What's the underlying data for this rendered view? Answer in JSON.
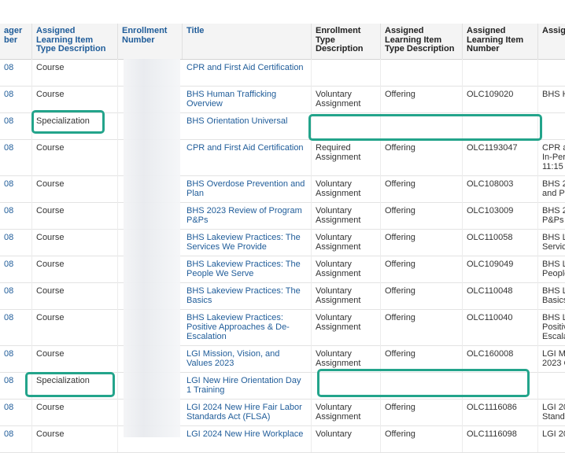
{
  "columns": [
    {
      "key": "c0",
      "label": "ager\nber"
    },
    {
      "key": "c1",
      "label": "Assigned Learning Item Type Description"
    },
    {
      "key": "c2",
      "label": "Enrollment Number"
    },
    {
      "key": "c3",
      "label": "Title"
    },
    {
      "key": "c4",
      "label": "Enrollment Type Description"
    },
    {
      "key": "c5",
      "label": "Assigned Learning Item Type Description"
    },
    {
      "key": "c6",
      "label": "Assigned Learning Item Number"
    },
    {
      "key": "c7",
      "label": "Assig"
    }
  ],
  "rows": [
    {
      "c0": "08",
      "c1": "Course",
      "c3": "CPR and First Aid Certification",
      "c4": "",
      "c5": "",
      "c6": "",
      "c7": ""
    },
    {
      "c0": "08",
      "c1": "Course",
      "c3": "BHS Human Trafficking Overview",
      "c4": "Voluntary Assignment",
      "c5": "Offering",
      "c6": "OLC109020",
      "c7": "BHS H"
    },
    {
      "c0": "08",
      "c1": "Specialization",
      "c3": "BHS Orientation Universal",
      "c4": "",
      "c5": "",
      "c6": "",
      "c7": ""
    },
    {
      "c0": "08",
      "c1": "Course",
      "c3": "CPR and First Aid Certification",
      "c4": "Required Assignment",
      "c5": "Offering",
      "c6": "OLC1193047",
      "c7": "CPR a\nIn-Pers\n11:15"
    },
    {
      "c0": "08",
      "c1": "Course",
      "c3": "BHS Overdose Prevention and Plan",
      "c4": "Voluntary Assignment",
      "c5": "Offering",
      "c6": "OLC108003",
      "c7": "BHS 2\nand P"
    },
    {
      "c0": "08",
      "c1": "Course",
      "c3": "BHS 2023 Review of Program P&Ps",
      "c4": "Voluntary Assignment",
      "c5": "Offering",
      "c6": "OLC103009",
      "c7": "BHS 2\nP&Ps"
    },
    {
      "c0": "08",
      "c1": "Course",
      "c3": "BHS Lakeview Practices: The Services We Provide",
      "c4": "Voluntary Assignment",
      "c5": "Offering",
      "c6": "OLC110058",
      "c7": "BHS L\nServic"
    },
    {
      "c0": "08",
      "c1": "Course",
      "c3": "BHS Lakeview Practices: The People We Serve",
      "c4": "Voluntary Assignment",
      "c5": "Offering",
      "c6": "OLC109049",
      "c7": "BHS L\nPeople"
    },
    {
      "c0": "08",
      "c1": "Course",
      "c3": "BHS Lakeview Practices: The Basics",
      "c4": "Voluntary Assignment",
      "c5": "Offering",
      "c6": "OLC110048",
      "c7": "BHS L\nBasics"
    },
    {
      "c0": "08",
      "c1": "Course",
      "c3": "BHS Lakeview Practices: Positive Approaches & De-Escalation",
      "c4": "Voluntary Assignment",
      "c5": "Offering",
      "c6": "OLC110040",
      "c7": "BHS L\nPositiv\nEscala"
    },
    {
      "c0": "08",
      "c1": "Course",
      "c3": "LGI Mission, Vision, and Values 2023",
      "c4": "Voluntary Assignment",
      "c5": "Offering",
      "c6": "OLC160008",
      "c7": "LGI M\n2023 C"
    },
    {
      "c0": "08",
      "c1": "Specialization",
      "c3": "LGI New Hire Orientation Day 1 Training",
      "c4": "",
      "c5": "",
      "c6": "",
      "c7": ""
    },
    {
      "c0": "08",
      "c1": "Course",
      "c3": "LGI 2024 New Hire Fair Labor Standards Act (FLSA)",
      "c4": "Voluntary Assignment",
      "c5": "Offering",
      "c6": "OLC1116086",
      "c7": "LGI 20\nStand"
    },
    {
      "c0": "08",
      "c1": "Course",
      "c3": "LGI 2024 New Hire Workplace",
      "c4": "Voluntary",
      "c5": "Offering",
      "c6": "OLC1116098",
      "c7": "LGI 20"
    }
  ]
}
